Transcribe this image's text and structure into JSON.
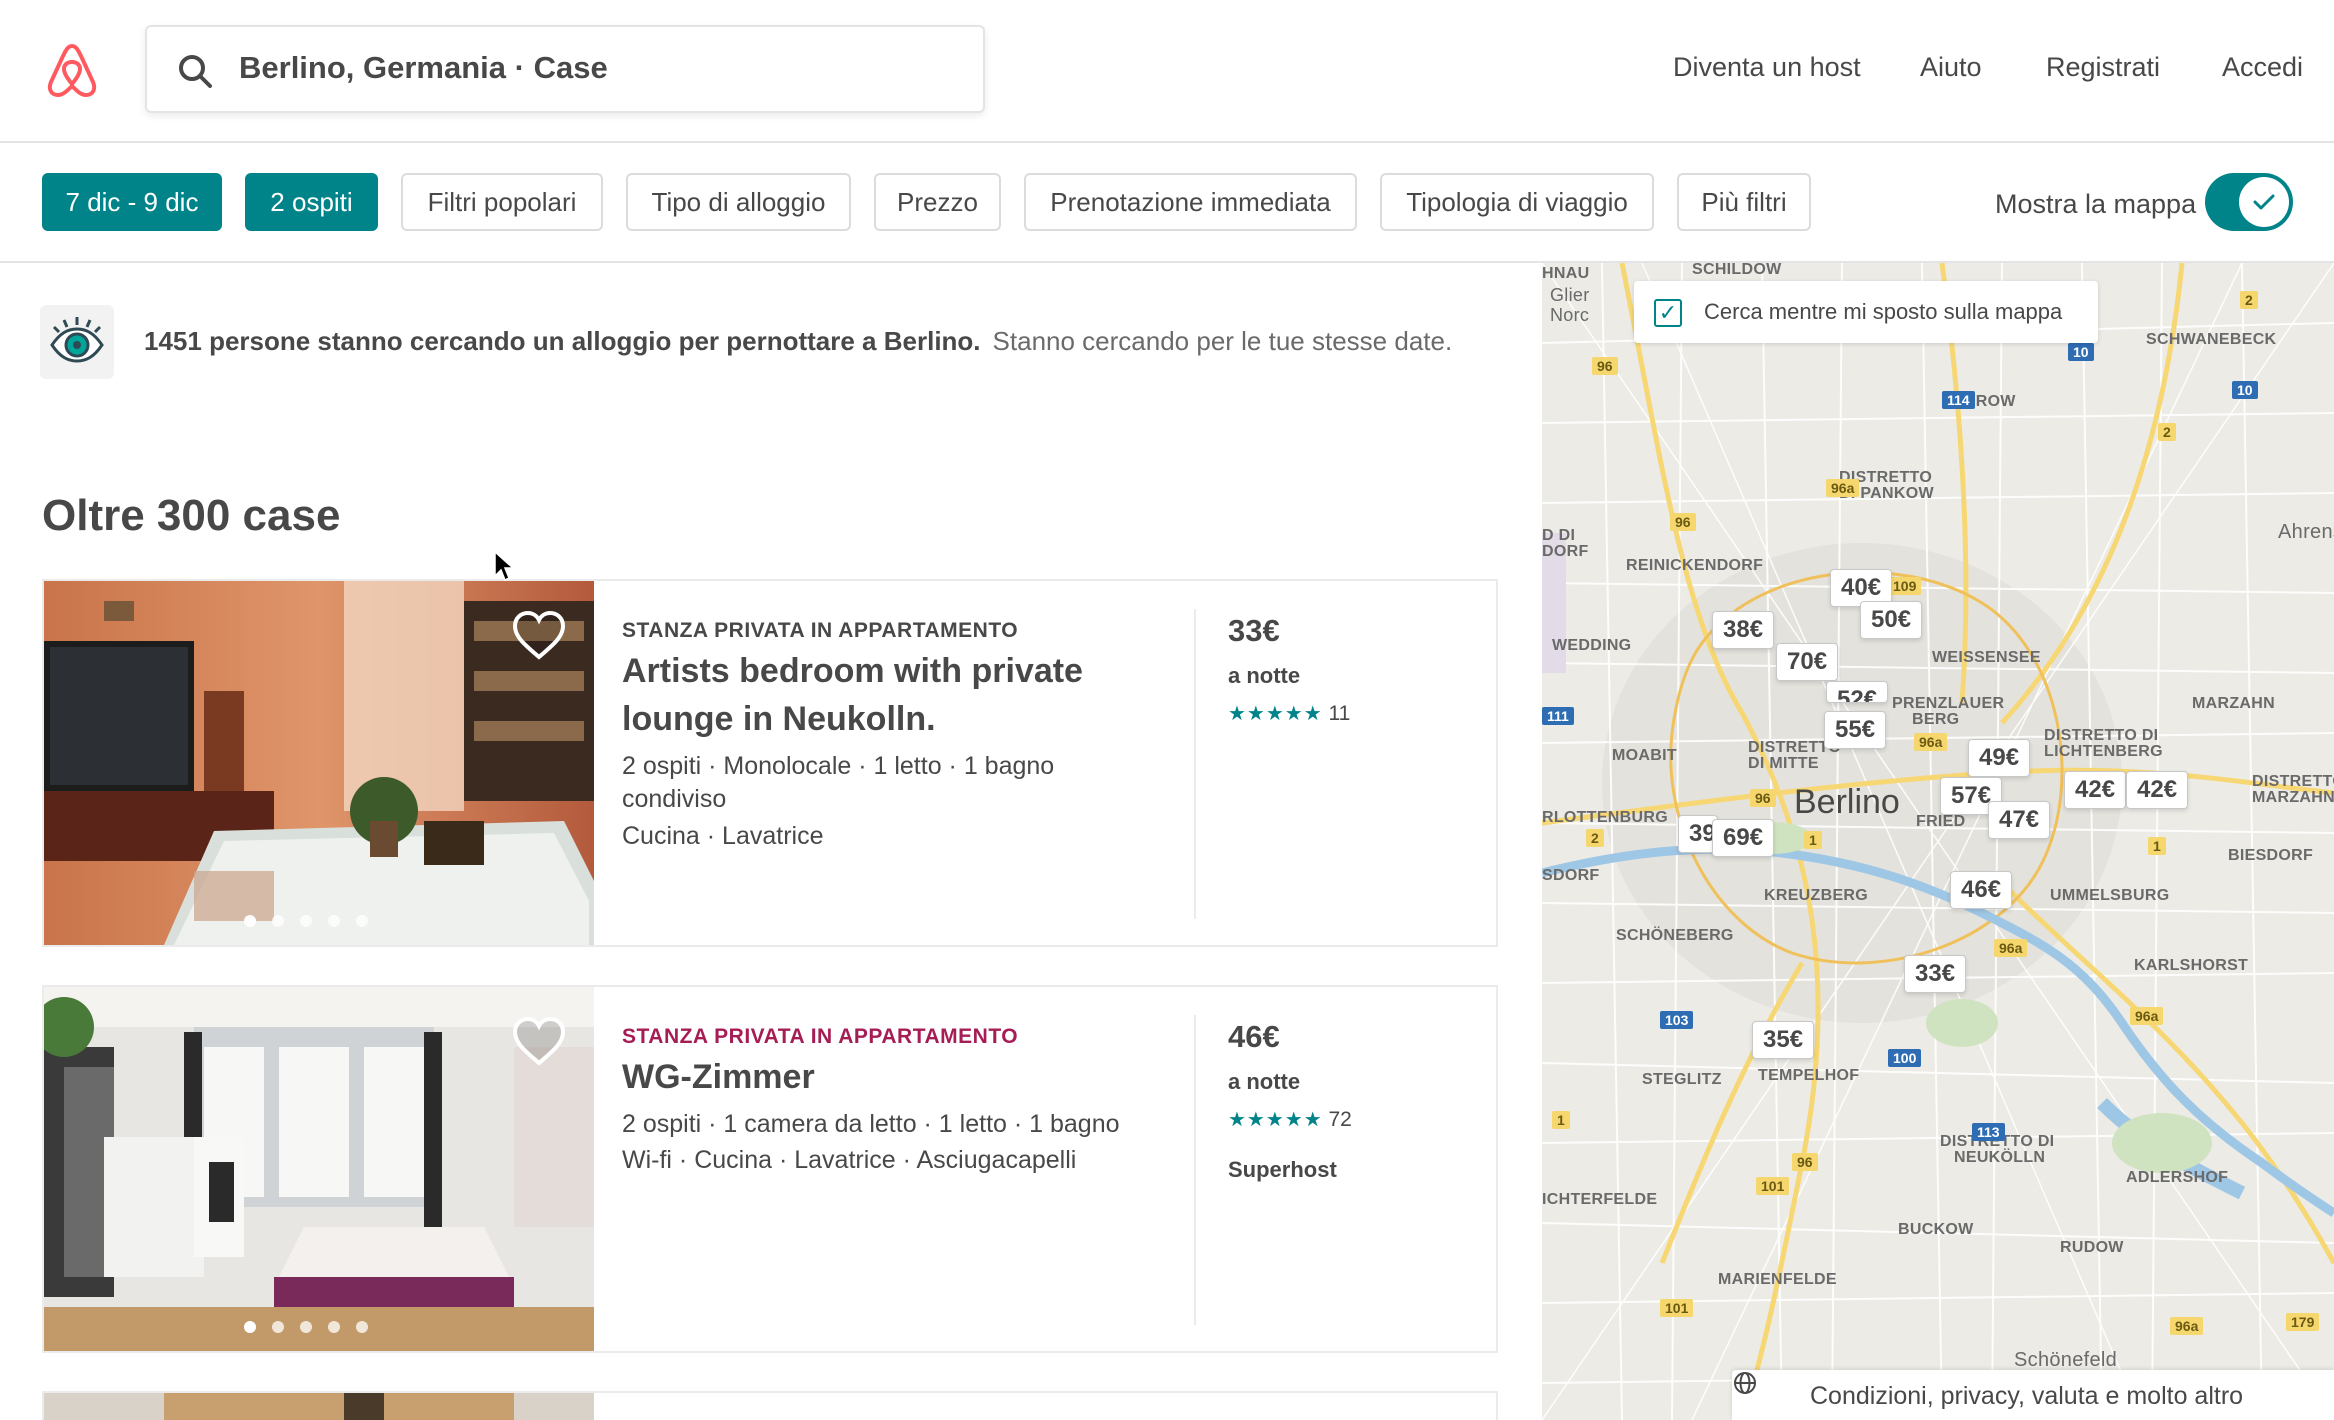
{
  "header": {
    "logo": "airbnb-logo",
    "search_value": "Berlino, Germania · Case",
    "nav": [
      "Diventa un host",
      "Aiuto",
      "Registrati",
      "Accedi"
    ]
  },
  "filters": {
    "dates": "7 dic - 9 dic",
    "guests": "2 ospiti",
    "popular": "Filtri popolari",
    "stay_type": "Tipo di alloggio",
    "price": "Prezzo",
    "instant_book": "Prenotazione immediata",
    "trip_type": "Tipologia di viaggio",
    "more": "Più filtri",
    "show_map_label": "Mostra la mappa",
    "show_map_on": true
  },
  "notice": {
    "bold": "1451 persone stanno cercando un alloggio per pernottare a Berlino.",
    "sub": "Stanno cercando per le tue stesse date."
  },
  "results_title": "Oltre 300 case",
  "listings": [
    {
      "kind": "STANZA PRIVATA IN APPARTAMENTO",
      "kind_color": "#484848",
      "title_line1": "Artists bedroom with private",
      "title_line2": "lounge in Neukolln.",
      "details_line1": "2 ospiti · Monolocale · 1 letto · 1 bagno",
      "details_line2": "condiviso",
      "amenities": "Cucina · Lavatrice",
      "price": "33€",
      "per_night": "a notte",
      "stars": "★★★★★",
      "reviews": "11",
      "rating": 4.5
    },
    {
      "kind": "STANZA PRIVATA IN APPARTAMENTO",
      "kind_color": "#a61d55",
      "title_line1": "WG-Zimmer",
      "details_line1": "2 ospiti · 1 camera da letto · 1 letto · 1 bagno",
      "amenities": "Wi-fi · Cucina · Lavatrice · Asciugacapelli",
      "price": "46€",
      "per_night": "a notte",
      "stars": "★★★★★",
      "reviews": "72",
      "rating": 4.5,
      "badge": "Superhost"
    }
  ],
  "map": {
    "search_as_move": "Cerca mentre mi sposto sulla mappa",
    "search_as_move_checked": true,
    "city": "Berlino",
    "districts": {
      "schildow": "SCHILDOW",
      "schwanebeck": "SCHWANEBECK",
      "karow": "KAROW",
      "pankow_1": "DISTRETTO",
      "pankow_2": "DI PANKOW",
      "reinickendorf": "REINICKENDORF",
      "ahrensfelde": "Ahrensfel",
      "wedding": "WEDDING",
      "weissensee": "WEISSENSEE",
      "marzahn": "MARZAHN",
      "prenzlauer_1": "PRENZLAUER",
      "prenzlauer_2": "BERG",
      "mitte_1": "DISTRETTO",
      "mitte_2": "DI MITTE",
      "moabit": "MOABIT",
      "lichtenberg_1": "DISTRETTO DI",
      "lichtenberg_2": "LICHTENBERG",
      "marzahn_hell_1": "DISTRETTO",
      "marzahn_hell_2": "MARZAHN-HELL",
      "charlottenburg": "RLOTTENBURG",
      "friedrichshain": "FRIED",
      "biesdorf": "BIESDORF",
      "kreuzberg": "KREUZBERG",
      "rummelsburg": "UMMELSBURG",
      "orf": "SDORF",
      "schoeneberg": "SCHÖNEBERG",
      "karlshorst": "KARLSHORST",
      "steglitz": "STEGLITZ",
      "tempelhof": "TEMPELHOF",
      "neukolln_1": "DISTRETTO DI",
      "neukolln_2": "NEUKÖLLN",
      "adlershof": "ADLERSHOF",
      "lichterfelde": "ICHTERFELDE",
      "buckow": "BUCKOW",
      "rudow": "RUDOW",
      "marienfelde": "MARIENFELDE",
      "schoenefeld": "Schönefeld",
      "glienicke_1": "Glier",
      "glienicke_2": "Norc",
      "hnau": "HNAU",
      "dorf_1": "D DI",
      "dorf_2": "DORF"
    },
    "road_badges": [
      "96",
      "10",
      "114",
      "10",
      "2",
      "2",
      "96a",
      "96",
      "109",
      "111",
      "96a",
      "96",
      "2",
      "1",
      "1",
      "96a",
      "103",
      "100",
      "113",
      "96a",
      "1",
      "96",
      "101",
      "101",
      "96a",
      "179"
    ],
    "price_pins": [
      "40€",
      "38€",
      "50€",
      "70€",
      "52€",
      "55€",
      "49€",
      "57€",
      "42€",
      "42€",
      "47€",
      "39€",
      "69€",
      "46€",
      "33€",
      "35€"
    ],
    "footer": "Condizioni, privacy, valuta e molto altro"
  }
}
